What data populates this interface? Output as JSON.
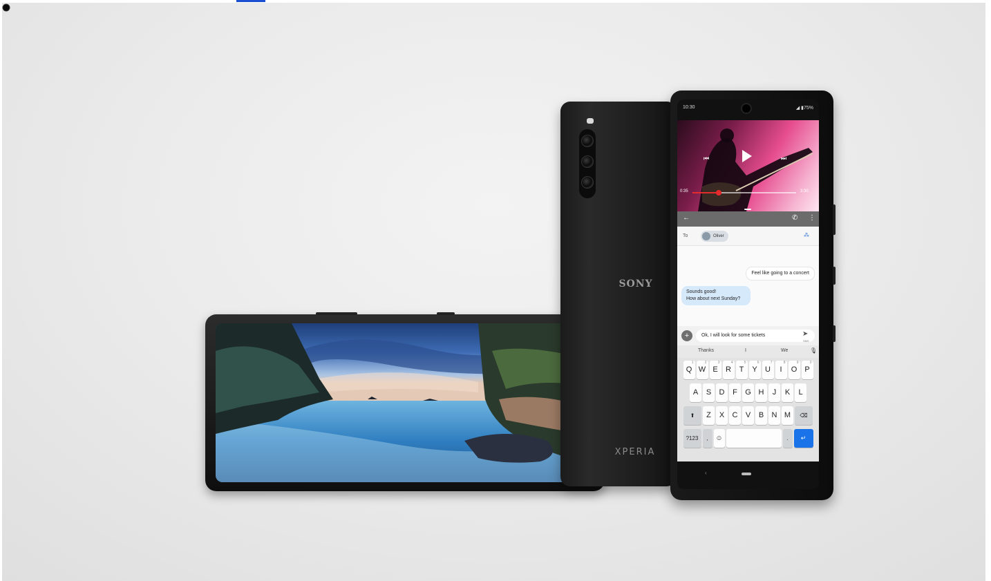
{
  "back_phone": {
    "brand_top": "SONY",
    "brand_bottom": "XPERIA"
  },
  "front_phone": {
    "status": {
      "time": "10:30",
      "battery": "◢ ▮75%"
    },
    "video": {
      "time_start": "0:35",
      "time_end": "3:30",
      "progress": 0.25
    },
    "conversation": {
      "to_label": "To",
      "recipient": "Oliver",
      "outgoing": "Feel like going to a concert",
      "incoming": "Sounds good!\nHow about next Sunday?",
      "compose_text": "Ok, I will look for some tickets",
      "send_sub": "SMS"
    },
    "suggestions": [
      "Thanks",
      "I",
      "We"
    ],
    "keyboard": {
      "row1": [
        "Q",
        "W",
        "E",
        "R",
        "T",
        "Y",
        "U",
        "I",
        "O",
        "P"
      ],
      "row1_hints": [
        "1",
        "2",
        "3",
        "4",
        "5",
        "6",
        "7",
        "8",
        "9",
        "0"
      ],
      "row2": [
        "A",
        "S",
        "D",
        "F",
        "G",
        "H",
        "J",
        "K",
        "L"
      ],
      "row3": [
        "Z",
        "X",
        "C",
        "V",
        "B",
        "N",
        "M"
      ],
      "symbols_key": "?123",
      "comma_key": ",",
      "period_key": "."
    }
  },
  "colors": {
    "video_accent": "#e52b2b",
    "incoming_bubble": "#d6e9fb",
    "enter_key": "#1a73e8"
  }
}
